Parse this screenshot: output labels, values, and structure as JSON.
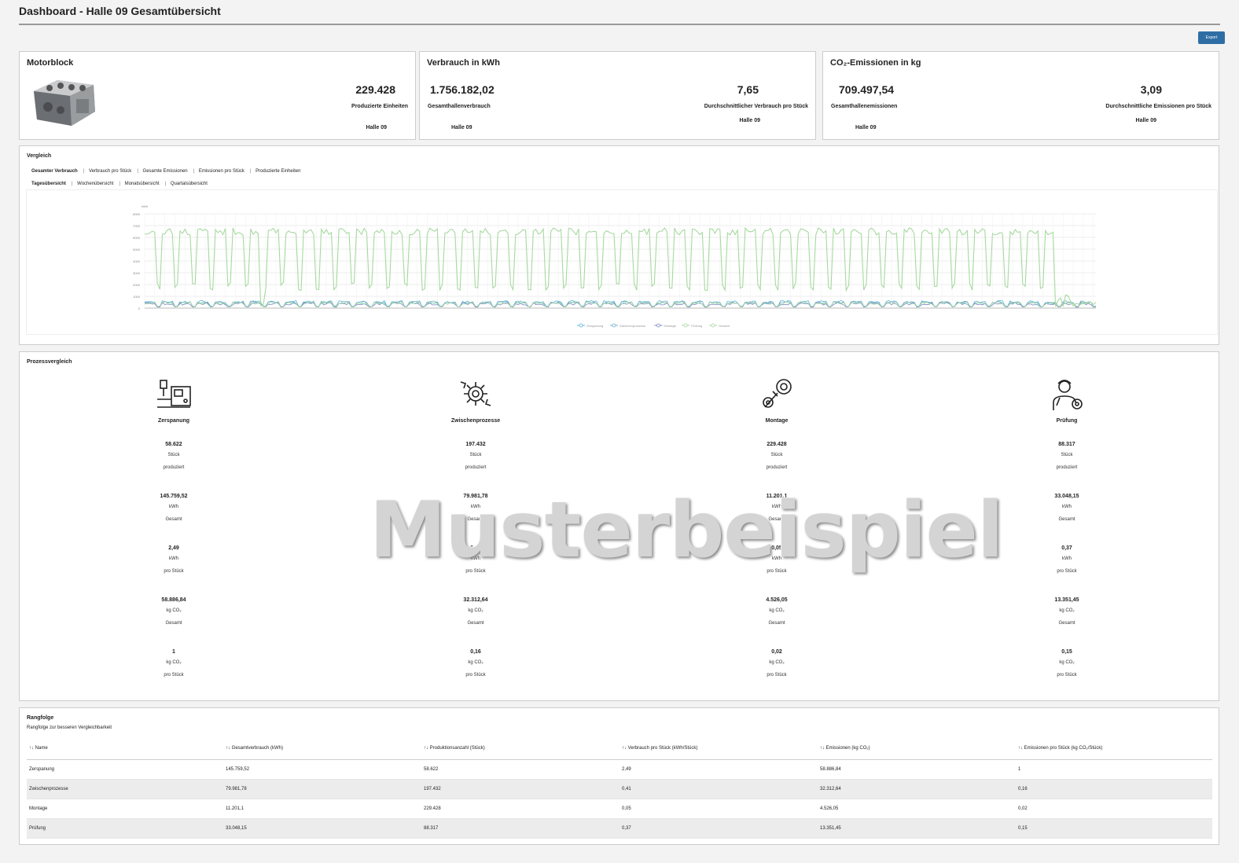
{
  "page": {
    "title": "Dashboard - Halle 09 Gesamtübersicht",
    "export_label": "Export"
  },
  "cards": {
    "motorblock": {
      "title": "Motorblock",
      "value": "229.428",
      "label": "Produzierte Einheiten",
      "hall": "Halle 09"
    },
    "verbrauch": {
      "title": "Verbrauch in kWh",
      "value1": "1.756.182,02",
      "label1": "Gesamthallenverbrauch",
      "hall1": "Halle 09",
      "value2": "7,65",
      "label2": "Durchschnittlicher Verbrauch pro Stück",
      "hall2": "Halle 09"
    },
    "co2": {
      "title": "CO₂-Emissionen in kg",
      "value1": "709.497,54",
      "label1": "Gesamthallenemissionen",
      "hall1": "Halle 09",
      "value2": "3,09",
      "label2": "Durchschnittliche Emissionen pro Stück",
      "hall2": "Halle 09"
    }
  },
  "vergleich": {
    "title": "Vergleich",
    "metric_tabs": [
      "Gesamter Verbrauch",
      "Verbrauch pro Stück",
      "Gesamte Emissionen",
      "Emissionen pro Stück",
      "Produzierte Einheiten"
    ],
    "period_tabs": [
      "Tagesübersicht",
      "Wochenübersicht",
      "Monatsübersicht",
      "Quartalsübersicht"
    ]
  },
  "chart_data": {
    "type": "line",
    "title": "",
    "ylabel": "kWh",
    "ylim": [
      0,
      8000
    ],
    "yticks": [
      "0",
      "1000",
      "2000",
      "3000",
      "4000",
      "5000",
      "6000",
      "7000",
      "8000"
    ],
    "series": [
      {
        "name": "Zerspanung",
        "color": "#5bb5d5",
        "pattern": "low"
      },
      {
        "name": "Zwischenprozesse",
        "color": "#6fb0c8",
        "pattern": "low"
      },
      {
        "name": "Montage",
        "color": "#7b86c6",
        "pattern": "low"
      },
      {
        "name": "Prüfung",
        "color": "#a7d9a0",
        "pattern": "low"
      },
      {
        "name": "Gesamt",
        "color": "#a7d9a0",
        "pattern": "weekly"
      }
    ],
    "gesamt_peak_kwh": 6800,
    "gesamt_low_kwh": 1500,
    "days": 378
  },
  "prozess": {
    "title": "Prozessvergleich",
    "items": [
      {
        "name": "Zerspanung",
        "icon": "machining-icon",
        "stueck": "58.622",
        "kwh_total": "145.759,52",
        "kwh_piece": "2,49",
        "co2_total": "58.886,84",
        "co2_piece": "1"
      },
      {
        "name": "Zwischenprozesse",
        "icon": "gears-arrows-icon",
        "stueck": "197.432",
        "kwh_total": "79.981,78",
        "kwh_piece": "0,41",
        "co2_total": "32.312,64",
        "co2_piece": "0,16"
      },
      {
        "name": "Montage",
        "icon": "wrench-gear-icon",
        "stueck": "229.428",
        "kwh_total": "11.201,1",
        "kwh_piece": "0,05",
        "co2_total": "4.526,05",
        "co2_piece": "0,02"
      },
      {
        "name": "Prüfung",
        "icon": "worker-gear-icon",
        "stueck": "88.317",
        "kwh_total": "33.048,15",
        "kwh_piece": "0,37",
        "co2_total": "13.351,45",
        "co2_piece": "0,15"
      }
    ],
    "labels": {
      "stueck": "Stück",
      "produziert": "produziert",
      "kwh": "kWh",
      "gesamt": "Gesamt",
      "pro_stueck": "pro Stück",
      "kgco2": "kg CO₂"
    }
  },
  "watermark": "Musterbeispiel",
  "rang": {
    "title": "Rangfolge",
    "subtitle": "Rangfolge zur besseren Vergleichbarkeit",
    "columns": [
      "Name",
      "Gesamtverbrauch (kWh)",
      "Produktionsanzahl (Stück)",
      "Verbrauch pro Stück (kWh/Stück)",
      "Emissionen (kg CO₂)",
      "Emissionen pro Stück (kg CO₂/Stück)"
    ],
    "rows": [
      [
        "Zerspanung",
        "145.759,52",
        "58.622",
        "2,49",
        "58.886,84",
        "1"
      ],
      [
        "Zwischenprozesse",
        "79.981,78",
        "197.432",
        "0,41",
        "32.312,64",
        "0,16"
      ],
      [
        "Montage",
        "11.201,1",
        "229.428",
        "0,05",
        "4.526,05",
        "0,02"
      ],
      [
        "Prüfung",
        "33.048,15",
        "88.317",
        "0,37",
        "13.351,45",
        "0,15"
      ]
    ]
  }
}
